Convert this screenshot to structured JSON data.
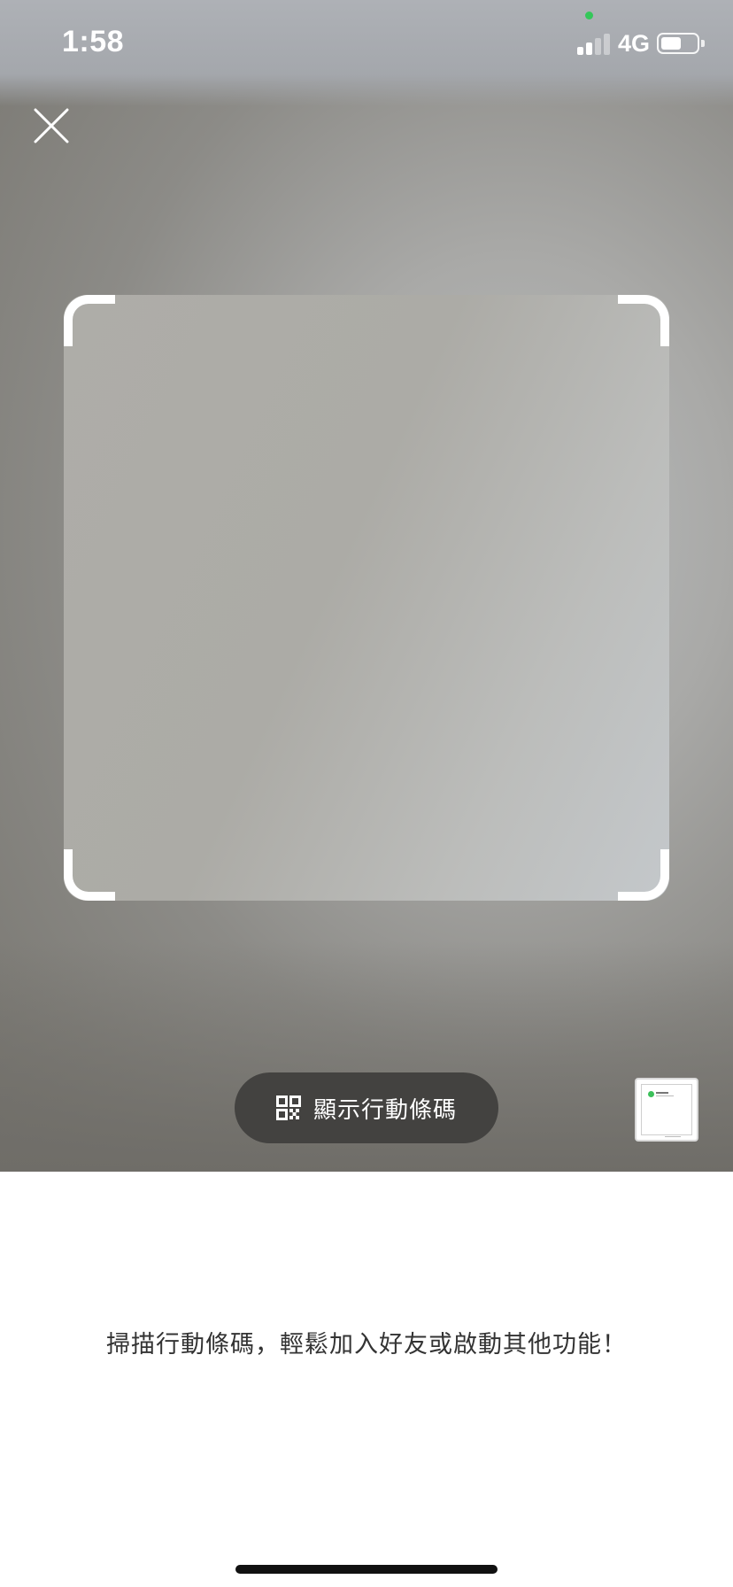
{
  "status_bar": {
    "time": "1:58",
    "network": "4G",
    "signal_bars_active": 2,
    "signal_bars_total": 4,
    "battery_level": 0.6
  },
  "header": {
    "close_icon": "close-icon"
  },
  "scanner": {
    "frame_color": "#ffffff"
  },
  "actions": {
    "show_qr_label": "顯示行動條碼",
    "show_qr_icon": "qr-code-icon",
    "gallery_icon": "gallery-thumbnail"
  },
  "bottom": {
    "hint": "掃描行動條碼，輕鬆加入好友或啟動其他功能！"
  },
  "colors": {
    "button_bg": "#434240",
    "accent_green": "#34c759"
  }
}
